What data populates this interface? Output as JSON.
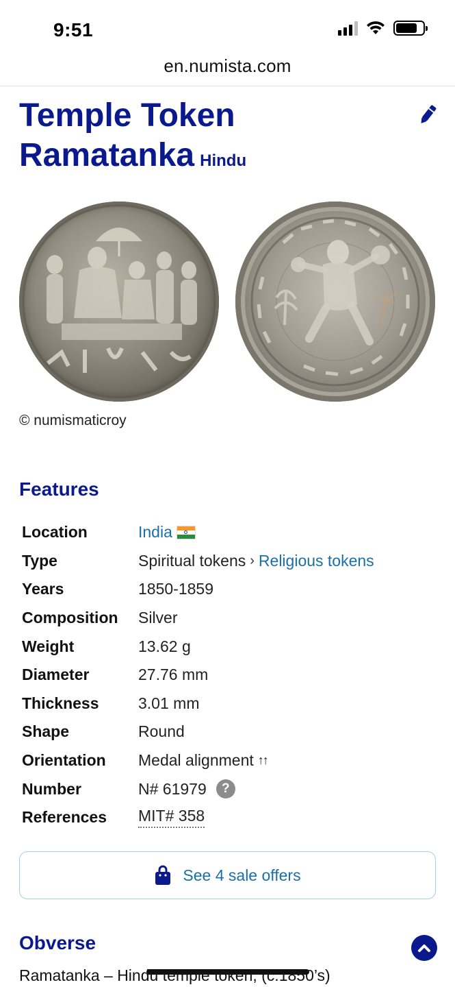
{
  "status_bar": {
    "time": "9:51"
  },
  "browser": {
    "url": "en.numista.com"
  },
  "title": {
    "line1": "Temple Token",
    "line2": "Ramatanka",
    "subtitle": "Hindu"
  },
  "image_credit": "© numismaticroy",
  "features": {
    "heading": "Features",
    "rows": [
      {
        "label": "Location",
        "value": "India"
      },
      {
        "label": "Type",
        "value": "Spiritual tokens",
        "value_link": "Religious tokens"
      },
      {
        "label": "Years",
        "value": "1850-1859"
      },
      {
        "label": "Composition",
        "value": "Silver"
      },
      {
        "label": "Weight",
        "value": "13.62 g"
      },
      {
        "label": "Diameter",
        "value": "27.76 mm"
      },
      {
        "label": "Thickness",
        "value": "3.01 mm"
      },
      {
        "label": "Shape",
        "value": "Round"
      },
      {
        "label": "Orientation",
        "value": "Medal alignment",
        "value_suffix": "↑↑"
      },
      {
        "label": "Number",
        "value": "N# 61979",
        "help": "?"
      },
      {
        "label": "References",
        "value": "MIT# 358"
      }
    ]
  },
  "sale_button": {
    "label": "See 4 sale offers"
  },
  "obverse": {
    "heading": "Obverse",
    "description": "Ramatanka – Hindu temple token, (c.1850’s)"
  },
  "colors": {
    "heading": "#0a1a8c",
    "link": "#1a6fa8",
    "button_border": "#a8cbe6"
  },
  "icons": [
    "edit-pen-icon",
    "india-flag-icon",
    "help-icon",
    "shopping-bag-icon",
    "scroll-top-icon",
    "signal-icon",
    "wifi-icon",
    "battery-icon"
  ]
}
